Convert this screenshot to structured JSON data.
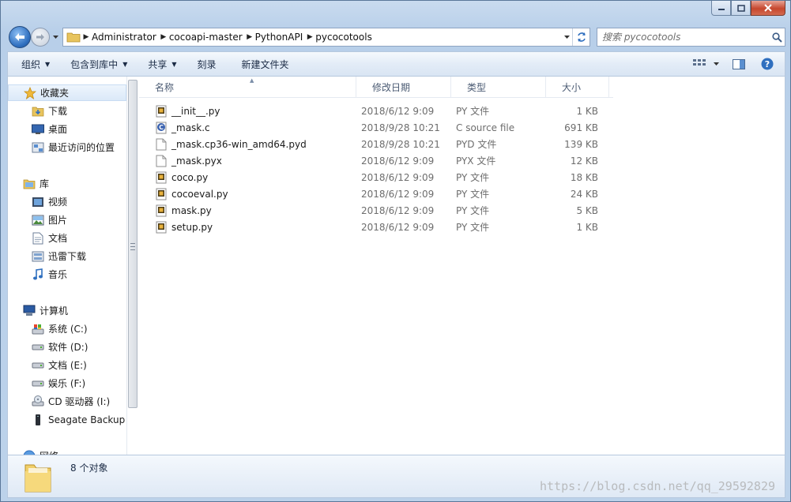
{
  "nav": {
    "breadcrumbs": [
      "Administrator",
      "cocoapi-master",
      "PythonAPI",
      "pycocotools"
    ],
    "search_placeholder": "搜索 pycocotools"
  },
  "toolbar": {
    "organize": "组织",
    "include_in_library": "包含到库中",
    "share": "共享",
    "burn": "刻录",
    "new_folder": "新建文件夹"
  },
  "sidebar": {
    "favorites": {
      "label": "收藏夹",
      "items": [
        "下载",
        "桌面",
        "最近访问的位置"
      ]
    },
    "libraries": {
      "label": "库",
      "items": [
        "视频",
        "图片",
        "文档",
        "迅雷下载",
        "音乐"
      ]
    },
    "computer": {
      "label": "计算机",
      "items": [
        "系统 (C:)",
        "软件 (D:)",
        "文档 (E:)",
        "娱乐 (F:)",
        "CD 驱动器 (I:)",
        "Seagate Backup"
      ]
    },
    "network": {
      "label": "网络"
    }
  },
  "columns": {
    "name": "名称",
    "modified": "修改日期",
    "type": "类型",
    "size": "大小"
  },
  "files": [
    {
      "name": "__init__.py",
      "modified": "2018/6/12 9:09",
      "type": "PY 文件",
      "size": "1 KB",
      "icon": "python-file-icon"
    },
    {
      "name": "_mask.c",
      "modified": "2018/9/28 10:21",
      "type": "C source file",
      "size": "691 KB",
      "icon": "c-source-file-icon"
    },
    {
      "name": "_mask.cp36-win_amd64.pyd",
      "modified": "2018/9/28 10:21",
      "type": "PYD 文件",
      "size": "139 KB",
      "icon": "blank-file-icon"
    },
    {
      "name": "_mask.pyx",
      "modified": "2018/6/12 9:09",
      "type": "PYX 文件",
      "size": "12 KB",
      "icon": "blank-file-icon"
    },
    {
      "name": "coco.py",
      "modified": "2018/6/12 9:09",
      "type": "PY 文件",
      "size": "18 KB",
      "icon": "python-file-icon"
    },
    {
      "name": "cocoeval.py",
      "modified": "2018/6/12 9:09",
      "type": "PY 文件",
      "size": "24 KB",
      "icon": "python-file-icon"
    },
    {
      "name": "mask.py",
      "modified": "2018/6/12 9:09",
      "type": "PY 文件",
      "size": "5 KB",
      "icon": "python-file-icon"
    },
    {
      "name": "setup.py",
      "modified": "2018/6/12 9:09",
      "type": "PY 文件",
      "size": "1 KB",
      "icon": "python-file-icon"
    }
  ],
  "details": {
    "item_count": "8 个对象"
  },
  "watermark": "https://blog.csdn.net/qq_29592829"
}
